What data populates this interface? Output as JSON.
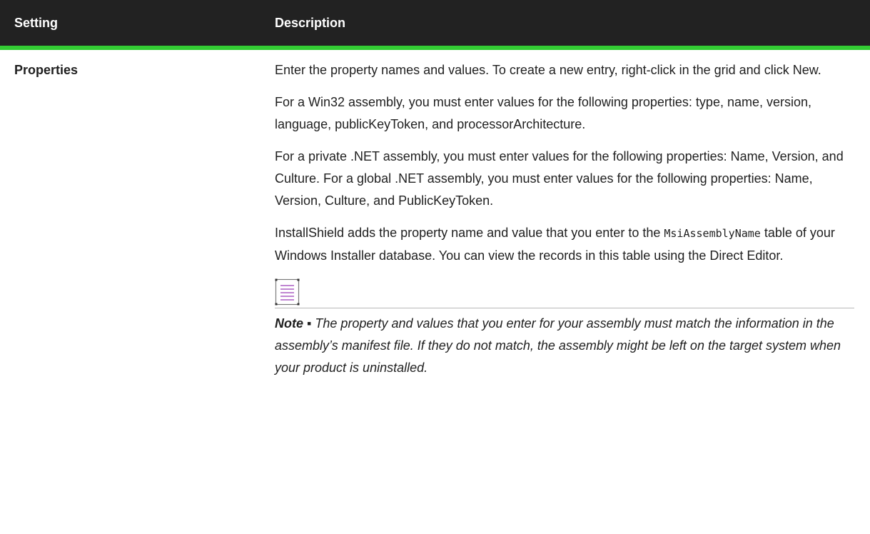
{
  "table": {
    "headers": {
      "setting": "Setting",
      "description": "Description"
    },
    "row": {
      "setting": "Properties",
      "p1": "Enter the property names and values. To create a new entry, right-click in the grid and click New.",
      "p2": "For a Win32 assembly, you must enter values for the following properties: type, name, version, language, publicKeyToken, and processorArchitecture.",
      "p3": "For a private .NET assembly, you must enter values for the following properties: Name, Version, and Culture. For a global .NET assembly, you must enter values for the following properties: Name, Version, Culture, and PublicKeyToken.",
      "p4_before": "InstallShield adds the property name and value that you enter to the ",
      "p4_code": "MsiAssemblyName",
      "p4_after": " table of your Windows Installer database. You can view the records in this table using the Direct Editor.",
      "note_icon": "note-icon",
      "note_label": "Note ▪ ",
      "note_text": "The property and values that you enter for your assembly must match the information in the assembly’s manifest file. If they do not match, the assembly might be left on the target system when your product is uninstalled."
    }
  },
  "colors": {
    "header_bg": "#222222",
    "header_rule": "#33cc33",
    "icon_accent": "#9b3fb6"
  }
}
